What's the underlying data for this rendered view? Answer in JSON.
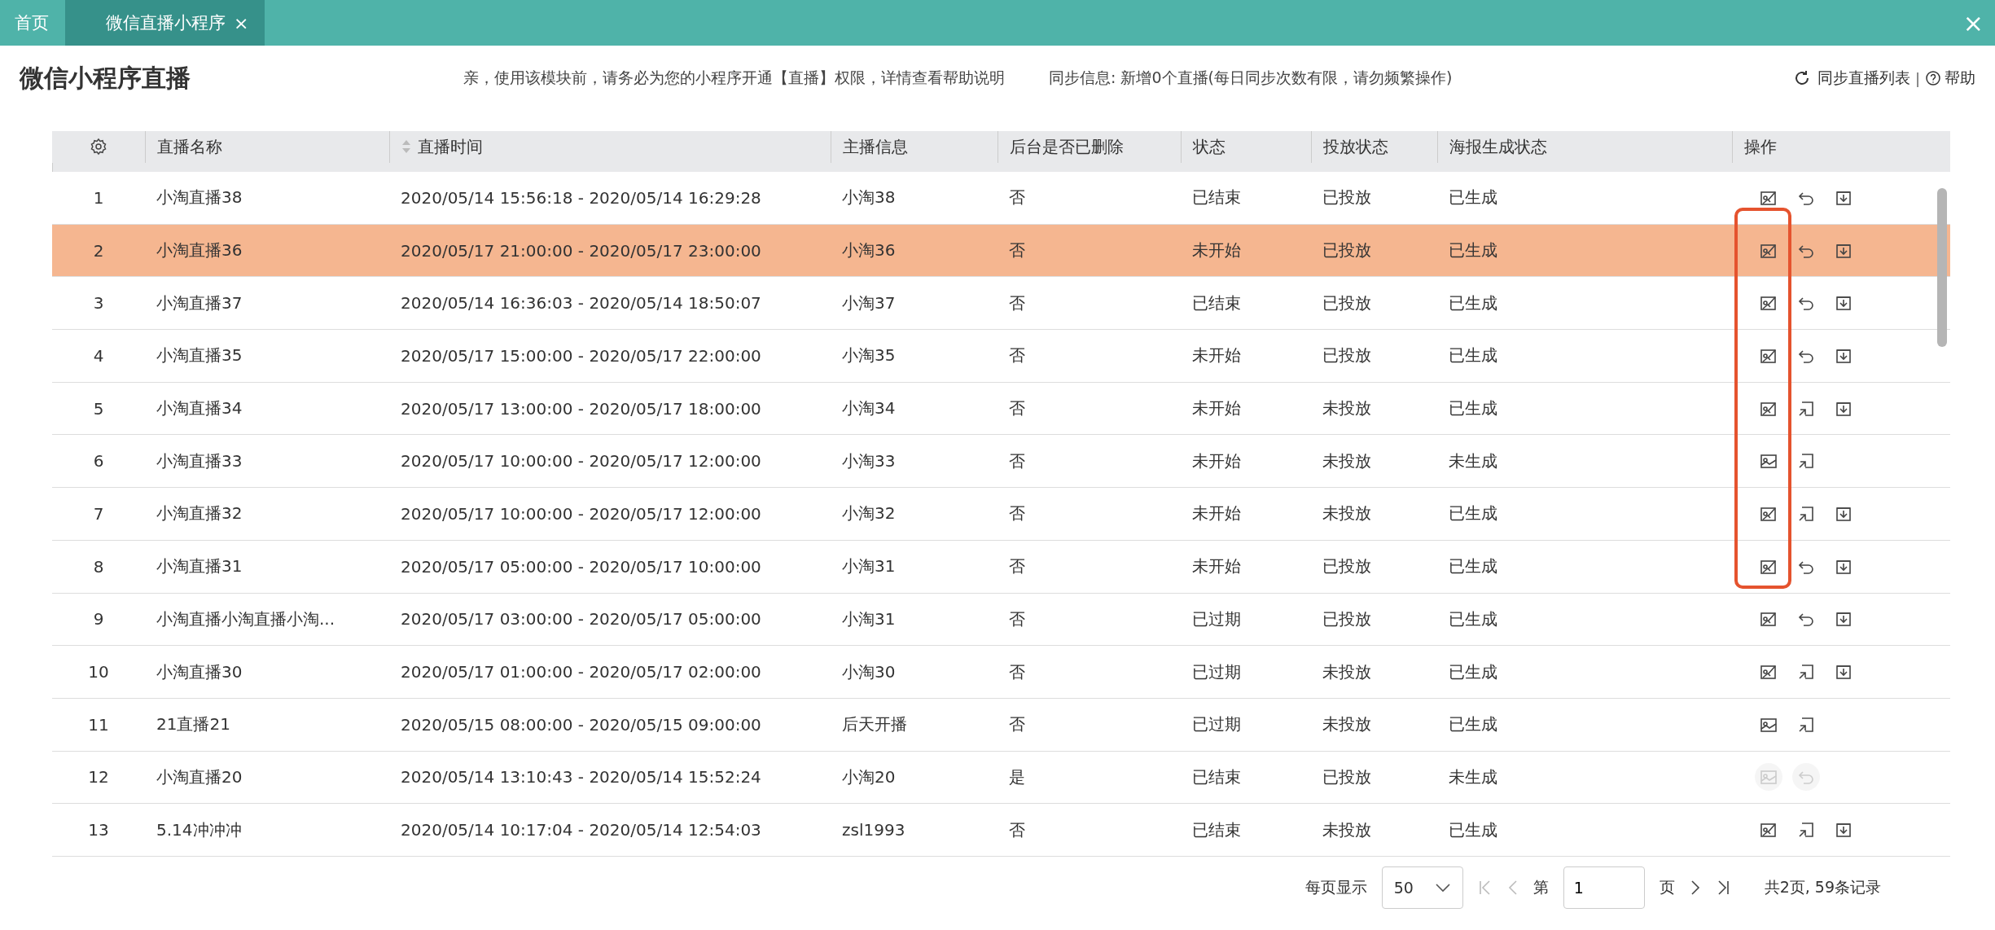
{
  "tabs": [
    {
      "label": "首页",
      "selected": false
    },
    {
      "label": "微信直播小程序",
      "selected": true,
      "close": "×"
    }
  ],
  "window_close": "×",
  "header": {
    "title": "微信小程序直播",
    "notice": "亲，使用该模块前，请务必为您的小程序开通【直播】权限，详情查看帮助说明",
    "sync_info": "同步信息: 新增0个直播(每日同步次数有限，请勿频繁操作)",
    "sync_button": "同步直播列表",
    "separator": "|",
    "help": "帮助"
  },
  "table": {
    "columns": [
      "直播名称",
      "直播时间",
      "主播信息",
      "后台是否已删除",
      "状态",
      "投放状态",
      "海报生成状态",
      "操作"
    ],
    "rows": [
      {
        "index": "1",
        "name": "小淘直播38",
        "time": "2020/05/14 15:56:18 - 2020/05/14 16:29:28",
        "anchor": "小淘38",
        "deleted": "否",
        "status": "已结束",
        "put": "已投放",
        "poster": "已生成",
        "selected": false,
        "actions": [
          {
            "kind": "edit",
            "disabled": false
          },
          {
            "kind": "undo",
            "disabled": false
          },
          {
            "kind": "download",
            "disabled": false
          }
        ]
      },
      {
        "index": "2",
        "name": "小淘直播36",
        "time": "2020/05/17 21:00:00 - 2020/05/17 23:00:00",
        "anchor": "小淘36",
        "deleted": "否",
        "status": "未开始",
        "put": "已投放",
        "poster": "已生成",
        "selected": true,
        "actions": [
          {
            "kind": "edit",
            "disabled": false
          },
          {
            "kind": "undo",
            "disabled": false
          },
          {
            "kind": "download",
            "disabled": false
          }
        ]
      },
      {
        "index": "3",
        "name": "小淘直播37",
        "time": "2020/05/14 16:36:03 - 2020/05/14 18:50:07",
        "anchor": "小淘37",
        "deleted": "否",
        "status": "已结束",
        "put": "已投放",
        "poster": "已生成",
        "selected": false,
        "actions": [
          {
            "kind": "edit",
            "disabled": false
          },
          {
            "kind": "undo",
            "disabled": false
          },
          {
            "kind": "download",
            "disabled": false
          }
        ]
      },
      {
        "index": "4",
        "name": "小淘直播35",
        "time": "2020/05/17 15:00:00 - 2020/05/17 22:00:00",
        "anchor": "小淘35",
        "deleted": "否",
        "status": "未开始",
        "put": "已投放",
        "poster": "已生成",
        "selected": false,
        "actions": [
          {
            "kind": "edit",
            "disabled": false
          },
          {
            "kind": "undo",
            "disabled": false
          },
          {
            "kind": "download",
            "disabled": false
          }
        ]
      },
      {
        "index": "5",
        "name": "小淘直播34",
        "time": "2020/05/17 13:00:00 - 2020/05/17 18:00:00",
        "anchor": "小淘34",
        "deleted": "否",
        "status": "未开始",
        "put": "未投放",
        "poster": "已生成",
        "selected": false,
        "actions": [
          {
            "kind": "edit",
            "disabled": false
          },
          {
            "kind": "share",
            "disabled": false
          },
          {
            "kind": "download",
            "disabled": false
          }
        ]
      },
      {
        "index": "6",
        "name": "小淘直播33",
        "time": "2020/05/17 10:00:00 - 2020/05/17 12:00:00",
        "anchor": "小淘33",
        "deleted": "否",
        "status": "未开始",
        "put": "未投放",
        "poster": "未生成",
        "selected": false,
        "actions": [
          {
            "kind": "image",
            "disabled": false
          },
          {
            "kind": "share",
            "disabled": false
          }
        ]
      },
      {
        "index": "7",
        "name": "小淘直播32",
        "time": "2020/05/17 10:00:00 - 2020/05/17 12:00:00",
        "anchor": "小淘32",
        "deleted": "否",
        "status": "未开始",
        "put": "未投放",
        "poster": "已生成",
        "selected": false,
        "actions": [
          {
            "kind": "edit",
            "disabled": false
          },
          {
            "kind": "share",
            "disabled": false
          },
          {
            "kind": "download",
            "disabled": false
          }
        ]
      },
      {
        "index": "8",
        "name": "小淘直播31",
        "time": "2020/05/17 05:00:00 - 2020/05/17 10:00:00",
        "anchor": "小淘31",
        "deleted": "否",
        "status": "未开始",
        "put": "已投放",
        "poster": "已生成",
        "selected": false,
        "actions": [
          {
            "kind": "edit",
            "disabled": false
          },
          {
            "kind": "undo",
            "disabled": false
          },
          {
            "kind": "download",
            "disabled": false
          }
        ]
      },
      {
        "index": "9",
        "name": "小淘直播小淘直播小淘...",
        "time": "2020/05/17 03:00:00 - 2020/05/17 05:00:00",
        "anchor": "小淘31",
        "deleted": "否",
        "status": "已过期",
        "put": "已投放",
        "poster": "已生成",
        "selected": false,
        "actions": [
          {
            "kind": "edit",
            "disabled": false
          },
          {
            "kind": "undo",
            "disabled": false
          },
          {
            "kind": "download",
            "disabled": false
          }
        ]
      },
      {
        "index": "10",
        "name": "小淘直播30",
        "time": "2020/05/17 01:00:00 - 2020/05/17 02:00:00",
        "anchor": "小淘30",
        "deleted": "否",
        "status": "已过期",
        "put": "未投放",
        "poster": "已生成",
        "selected": false,
        "actions": [
          {
            "kind": "edit",
            "disabled": false
          },
          {
            "kind": "share",
            "disabled": false
          },
          {
            "kind": "download",
            "disabled": false
          }
        ]
      },
      {
        "index": "11",
        "name": "21直播21",
        "time": "2020/05/15 08:00:00 - 2020/05/15 09:00:00",
        "anchor": "后天开播",
        "deleted": "否",
        "status": "已过期",
        "put": "未投放",
        "poster": "已生成",
        "selected": false,
        "actions": [
          {
            "kind": "image",
            "disabled": false
          },
          {
            "kind": "share",
            "disabled": false
          }
        ]
      },
      {
        "index": "12",
        "name": "小淘直播20",
        "time": "2020/05/14 13:10:43 - 2020/05/14 15:52:24",
        "anchor": "小淘20",
        "deleted": "是",
        "status": "已结束",
        "put": "已投放",
        "poster": "未生成",
        "selected": false,
        "actions": [
          {
            "kind": "image",
            "disabled": true
          },
          {
            "kind": "undo",
            "disabled": true
          }
        ]
      },
      {
        "index": "13",
        "name": "5.14冲冲冲",
        "time": "2020/05/14 10:17:04 - 2020/05/14 12:54:03",
        "anchor": "zsl1993",
        "deleted": "否",
        "status": "已结束",
        "put": "未投放",
        "poster": "已生成",
        "selected": false,
        "actions": [
          {
            "kind": "edit",
            "disabled": false
          },
          {
            "kind": "share",
            "disabled": false
          },
          {
            "kind": "download",
            "disabled": false
          }
        ]
      }
    ]
  },
  "pagination": {
    "page_size_label": "每页显示",
    "page_size": "50",
    "page_prefix": "第",
    "page": "1",
    "page_suffix": "页",
    "summary": "共2页, 59条记录"
  }
}
